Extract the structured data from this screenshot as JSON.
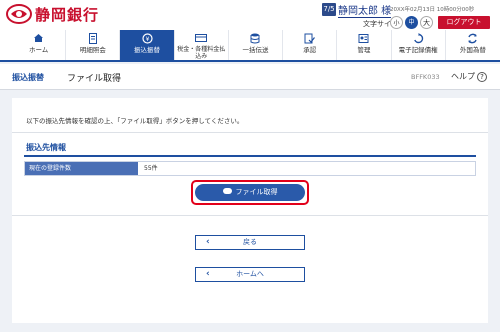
{
  "header": {
    "bank_name": "静岡銀行",
    "user_badge": "7/5",
    "user_name": "静岡太郎 様",
    "datetime": "20XX年02月13日 10時00分00秒",
    "font_size_label": "文字サイズ",
    "font_sizes": [
      "小",
      "中",
      "大"
    ],
    "logout_label": "ログアウト"
  },
  "nav": {
    "items": [
      {
        "label": "ホーム",
        "icon": "home-icon"
      },
      {
        "label": "明細照会",
        "icon": "document-icon"
      },
      {
        "label": "振込振替",
        "icon": "yen-transfer-icon",
        "active": true
      },
      {
        "label": "税金・各種料金払込み",
        "icon": "payment-icon"
      },
      {
        "label": "一括伝送",
        "icon": "database-icon"
      },
      {
        "label": "承認",
        "icon": "approval-icon"
      },
      {
        "label": "管理",
        "icon": "admin-icon"
      },
      {
        "label": "電子記録債権",
        "icon": "e-receivable-icon"
      },
      {
        "label": "外国為替",
        "icon": "forex-icon"
      }
    ]
  },
  "page": {
    "category": "振込振替",
    "title": "ファイル取得",
    "screen_code": "BFFK033",
    "help_label": "ヘルプ"
  },
  "main": {
    "instruction": "以下の振込先情報を確認の上、「ファイル取得」ボタンを押してください。",
    "section_title": "振込先情報",
    "row_label": "現在の登録件数",
    "row_value": "55件",
    "download_button_label": "ファイル取得",
    "back_button_label": "戻る",
    "home_button_label": "ホームへ"
  },
  "colors": {
    "brand_red": "#c8102e",
    "nav_blue": "#1e4fa0",
    "button_blue": "#2a5aaa",
    "highlight_red": "#e2001a"
  }
}
